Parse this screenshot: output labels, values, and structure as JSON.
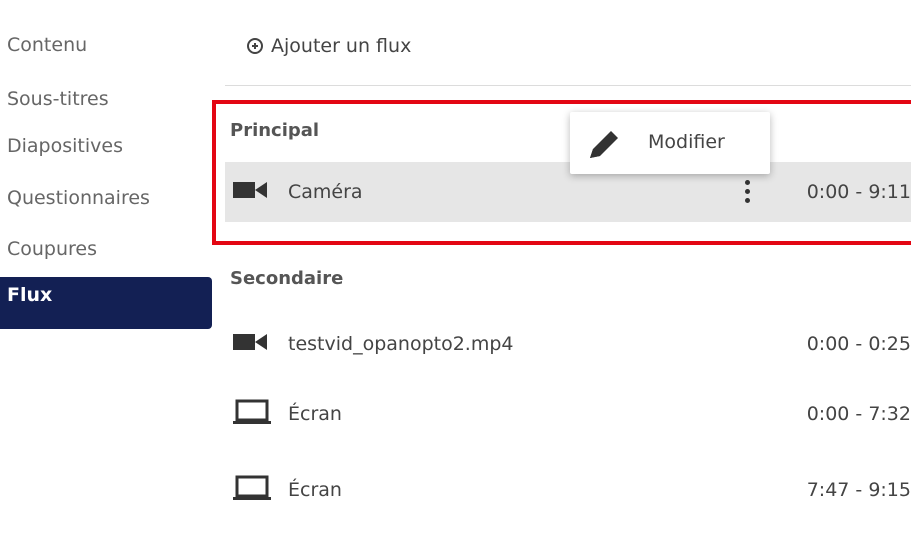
{
  "sidebar": {
    "items": [
      {
        "label": "Contenu",
        "active": false
      },
      {
        "label": "Sous-titres",
        "active": false
      },
      {
        "label": "Diapositives",
        "active": false
      },
      {
        "label": "Questionnaires",
        "active": false
      },
      {
        "label": "Coupures",
        "active": false
      },
      {
        "label": "Flux",
        "active": true
      }
    ]
  },
  "toolbar": {
    "add_stream_label": "Ajouter un flux",
    "add_icon": "plus-circle-icon"
  },
  "primary": {
    "title": "Principal",
    "streams": [
      {
        "name": "Caméra",
        "time": "0:00 - 9:11",
        "icon": "video-camera-icon",
        "selected": true
      }
    ]
  },
  "secondary": {
    "title": "Secondaire",
    "streams": [
      {
        "name": "testvid_opanopto2.mp4",
        "time": "0:00 - 0:25",
        "icon": "video-camera-icon"
      },
      {
        "name": "Écran",
        "time": "0:00 - 7:32",
        "icon": "laptop-icon"
      },
      {
        "name": "Écran",
        "time": "7:47 - 9:15",
        "icon": "laptop-icon"
      }
    ]
  },
  "context_menu": {
    "edit_label": "Modifier",
    "edit_icon": "pencil-icon"
  },
  "colors": {
    "active_nav": "#132054",
    "highlight": "#e30613",
    "selected_row": "#e6e6e6"
  }
}
